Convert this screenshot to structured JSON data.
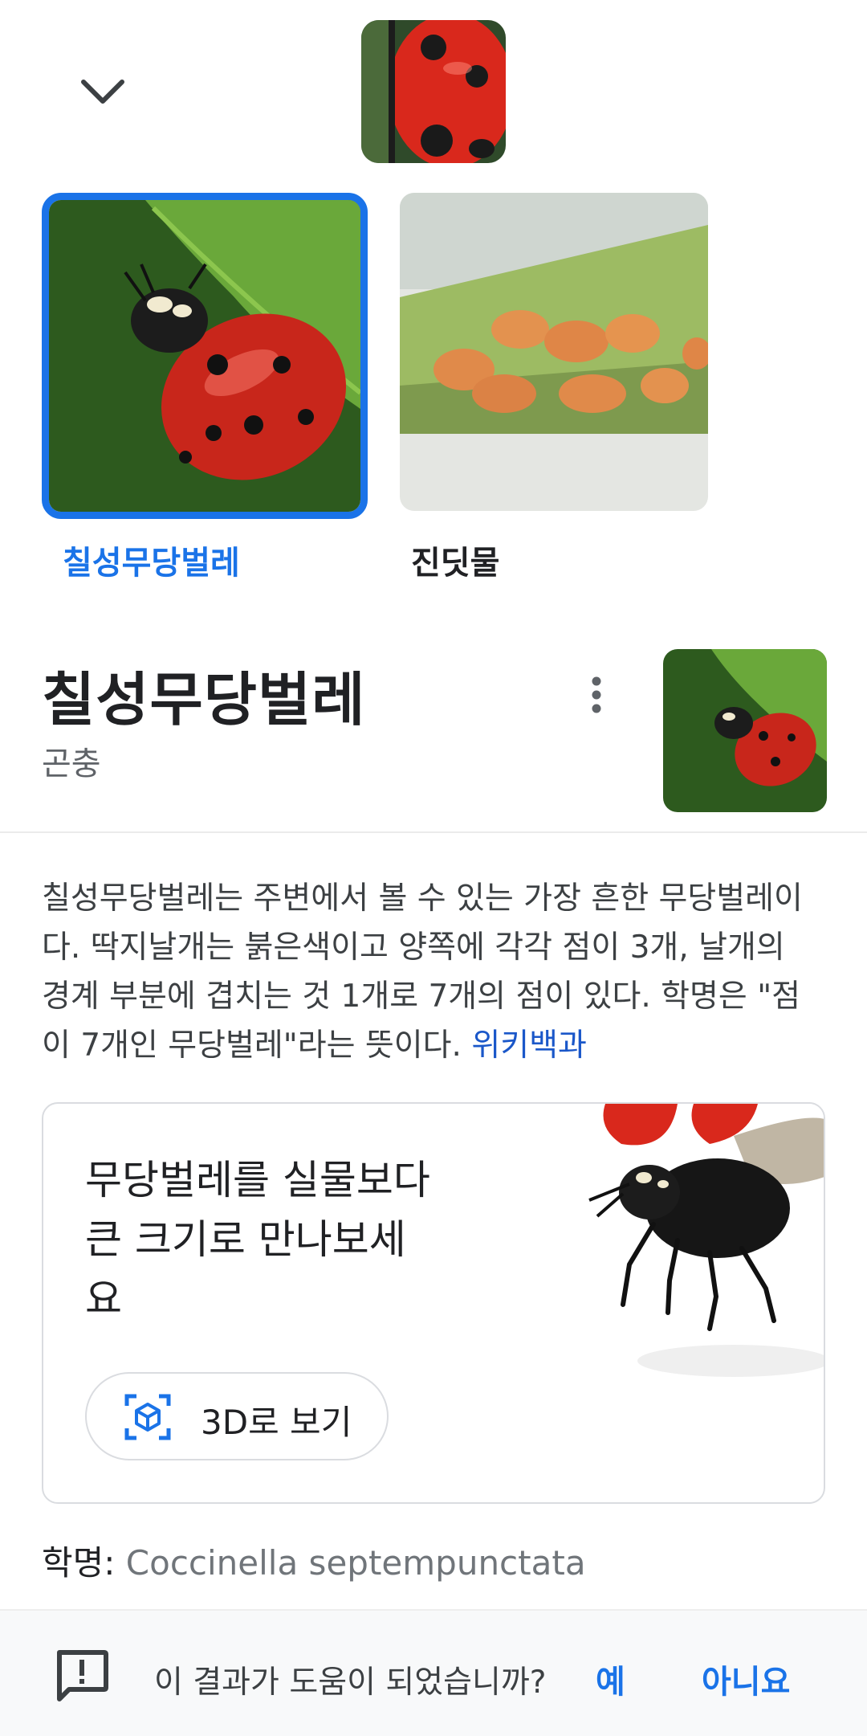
{
  "carousel": {
    "items": [
      {
        "label": "칠성무당벌레",
        "selected": true
      },
      {
        "label": "진딧물",
        "selected": false
      }
    ]
  },
  "entity": {
    "title": "칠성무당벌레",
    "subtitle": "곤충",
    "description": "칠성무당벌레는 주변에서 볼 수 있는 가장 흔한 무당벌레이다. 딱지날개는 붉은색이고 양쪽에 각각 점이 3개, 날개의 경계 부분에 겹치는 것 1개로 7개의 점이 있다. 학명은 \"점이 7개인 무당벌레\"라는 뜻이다.",
    "source_link": "위키백과"
  },
  "ar_card": {
    "title": "무당벌레를 실물보다 큰 크기로 만나보세요",
    "button_label": "3D로 보기"
  },
  "scientific_name": {
    "label": "학명:",
    "value": "Coccinella septempunctata"
  },
  "feedback": {
    "question": "이 결과가 도움이 되었습니까?",
    "yes": "예",
    "no": "아니요"
  },
  "icons": {
    "collapse": "chevron-down-icon",
    "more": "more-vert-icon",
    "view_3d": "cube-3d-icon",
    "feedback": "feedback-icon"
  },
  "colors": {
    "accent": "#1a73e8",
    "link": "#1a57c9",
    "text": "#202124",
    "secondary_text": "#5f6368"
  }
}
